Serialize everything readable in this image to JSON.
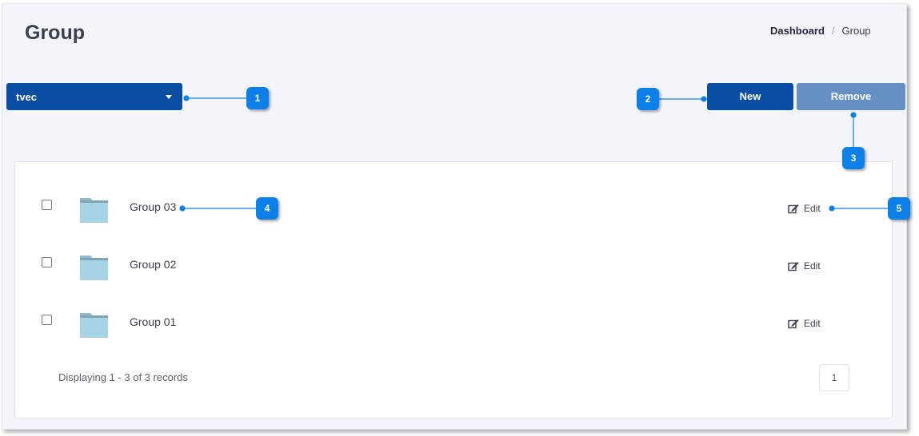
{
  "page": {
    "title": "Group"
  },
  "breadcrumb": {
    "dashboard": "Dashboard",
    "separator": "/",
    "current": "Group"
  },
  "toolbar": {
    "group_select_value": "tvec",
    "new_label": "New",
    "remove_label": "Remove"
  },
  "groups": [
    {
      "name": "Group 03",
      "edit_label": "Edit"
    },
    {
      "name": "Group 02",
      "edit_label": "Edit"
    },
    {
      "name": "Group 01",
      "edit_label": "Edit"
    }
  ],
  "footer": {
    "records_text": "Displaying 1 - 3 of 3 records",
    "page_number": "1"
  },
  "callouts": [
    "1",
    "2",
    "3",
    "4",
    "5"
  ],
  "colors": {
    "primary": "#0a4ea3",
    "remove": "#6690c4",
    "callout": "#0d7fe8",
    "folder": "#a6d4e4"
  }
}
